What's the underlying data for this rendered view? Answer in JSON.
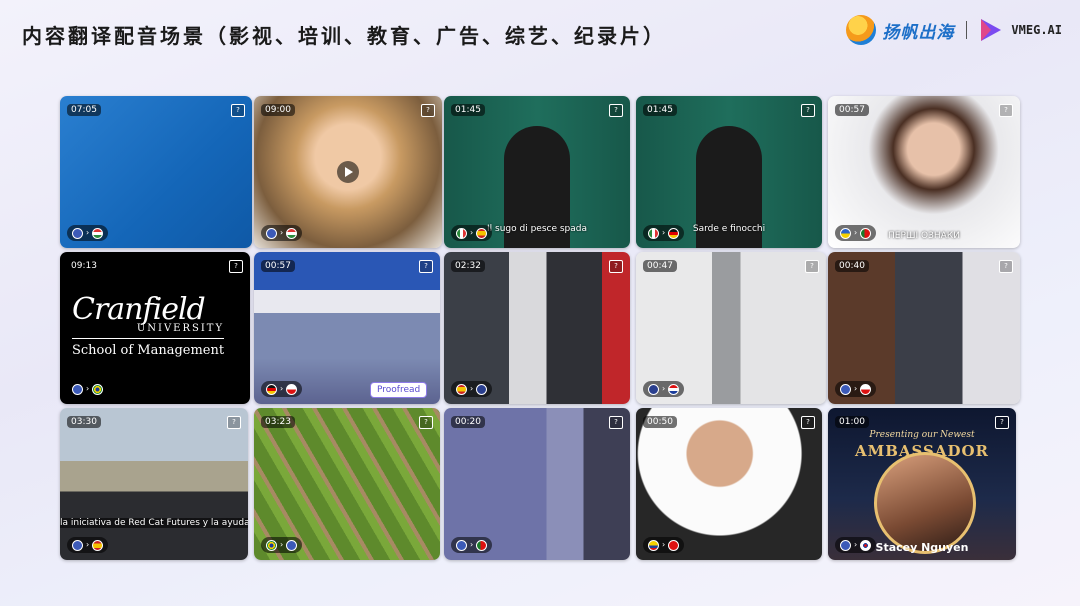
{
  "title": "内容翻译配音场景（影视、培训、教育、广告、综艺、纪录片）",
  "brand": {
    "name": "扬帆出海",
    "product": "VMEG.AI"
  },
  "colors": {
    "accent": "#1d6fc8",
    "vmeg": "#7b4bf0"
  },
  "videos": [
    {
      "time": "07:05",
      "flags": [
        "us",
        "hu"
      ]
    },
    {
      "time": "09:00",
      "flags": [
        "us",
        "hu"
      ]
    },
    {
      "time": "01:45",
      "flags": [
        "it",
        "es"
      ],
      "caption": "Il sugo di pesce spada"
    },
    {
      "time": "01:45",
      "flags": [
        "it",
        "de"
      ],
      "caption": "Sarde e finocchi"
    },
    {
      "time": "00:57",
      "flags": [
        "ua",
        "pt"
      ],
      "caption": "ПЕРШІ ОЗНАКИ"
    },
    {
      "time": "09:13",
      "flags": [
        "us",
        "br"
      ],
      "logo_main": "Cranfield",
      "logo_sub": "UNIVERSITY",
      "logo_school": "School of Management"
    },
    {
      "time": "00:57",
      "flags": [
        "de",
        "cz"
      ],
      "badge": "Proofread"
    },
    {
      "time": "02:32",
      "flags": [
        "es",
        "gb"
      ]
    },
    {
      "time": "00:47",
      "flags": [
        "gb",
        "hr"
      ]
    },
    {
      "time": "00:40",
      "flags": [
        "us",
        "cz"
      ]
    },
    {
      "time": "03:30",
      "flags": [
        "us",
        "es"
      ],
      "caption": "la iniciativa de Red Cat Futures y la ayuda de nu"
    },
    {
      "time": "03:23",
      "flags": [
        "br",
        "us"
      ]
    },
    {
      "time": "00:20",
      "flags": [
        "us",
        "pt"
      ]
    },
    {
      "time": "00:50",
      "flags": [
        "co",
        "vn"
      ]
    },
    {
      "time": "01:00",
      "flags": [
        "us",
        "kr"
      ],
      "top_text": "Presenting our Newest",
      "headline": "AMBASSADOR",
      "name": "Stacey Nguyen"
    }
  ]
}
